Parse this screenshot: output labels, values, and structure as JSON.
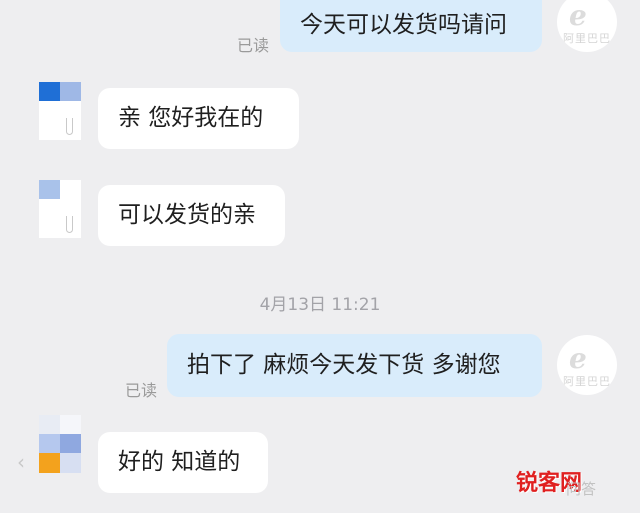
{
  "read_status": "已读",
  "timestamp": "4月13日 11:21",
  "messages": [
    {
      "side": "out",
      "text": "今天可以发货吗请问"
    },
    {
      "side": "in",
      "text": "亲  您好我在的"
    },
    {
      "side": "in",
      "text": "可以发货的亲"
    },
    {
      "side": "out",
      "text": "拍下了 麻烦今天发下货 多谢您"
    },
    {
      "side": "in",
      "text": "好的 知道的"
    }
  ],
  "logo": {
    "mark": "e",
    "text": "阿里巴巴"
  },
  "watermark": {
    "brand": "锐客网",
    "site": "问答"
  },
  "colors": {
    "background": "#eeeef0",
    "incoming_bubble": "#ffffff",
    "outgoing_bubble": "#d9ecfb",
    "read_text": "#9a9a9a",
    "watermark_brand": "#e02020"
  },
  "icons": {
    "back": "chevron-left-icon",
    "seller_logo": "alibaba-logo-icon"
  }
}
